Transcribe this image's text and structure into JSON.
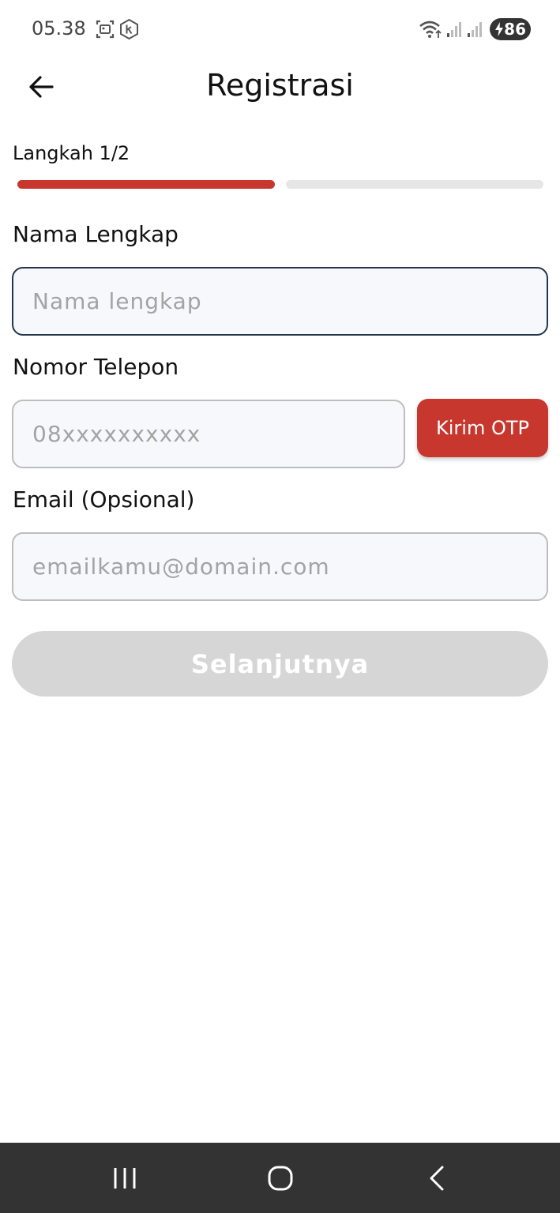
{
  "status_bar": {
    "time": "05.38",
    "battery_level": "86",
    "icons": [
      "gallery-icon",
      "k-app-icon",
      "wifi-icon",
      "signal-icon",
      "signal-icon",
      "battery-charging-icon"
    ]
  },
  "header": {
    "title": "Registrasi",
    "back_icon": "arrow-left-icon"
  },
  "step": {
    "label": "Langkah 1/2",
    "current": 1,
    "total": 2
  },
  "form": {
    "name_label": "Nama Lengkap",
    "name_placeholder": "Nama lengkap",
    "phone_label": "Nomor Telepon",
    "phone_placeholder": "08xxxxxxxxxx",
    "otp_button": "Kirim OTP",
    "email_label": "Email (Opsional)",
    "email_placeholder": "emailkamu@domain.com",
    "submit_label": "Selanjutnya"
  },
  "nav_bar": {
    "icons": [
      "recent-apps-icon",
      "home-icon",
      "back-icon"
    ]
  },
  "colors": {
    "accent": "#c8372d",
    "progress_inactive": "#e6e6e6",
    "button_disabled": "#d6d6d6",
    "focus_border": "#24364d",
    "nav_background": "#333333"
  }
}
